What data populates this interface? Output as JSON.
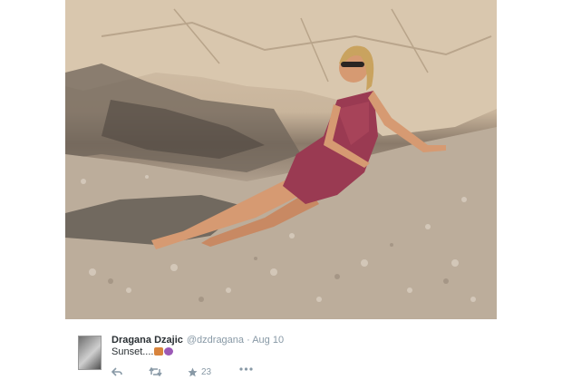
{
  "tweet": {
    "display_name": "Dragana Dzajic",
    "handle": "@dzdragana",
    "separator": "·",
    "date": "Aug 10",
    "text": "Sunset....",
    "emojis": [
      "orange-emoji",
      "purple-emoji"
    ],
    "actions": {
      "reply_icon": "reply-icon",
      "retweet_icon": "retweet-icon",
      "favorite_icon": "star-icon",
      "favorite_count": "23",
      "more_icon": "more-icon"
    }
  },
  "colors": {
    "text": "#292f33",
    "muted": "#8899a6",
    "dress": "#9a3a52"
  }
}
